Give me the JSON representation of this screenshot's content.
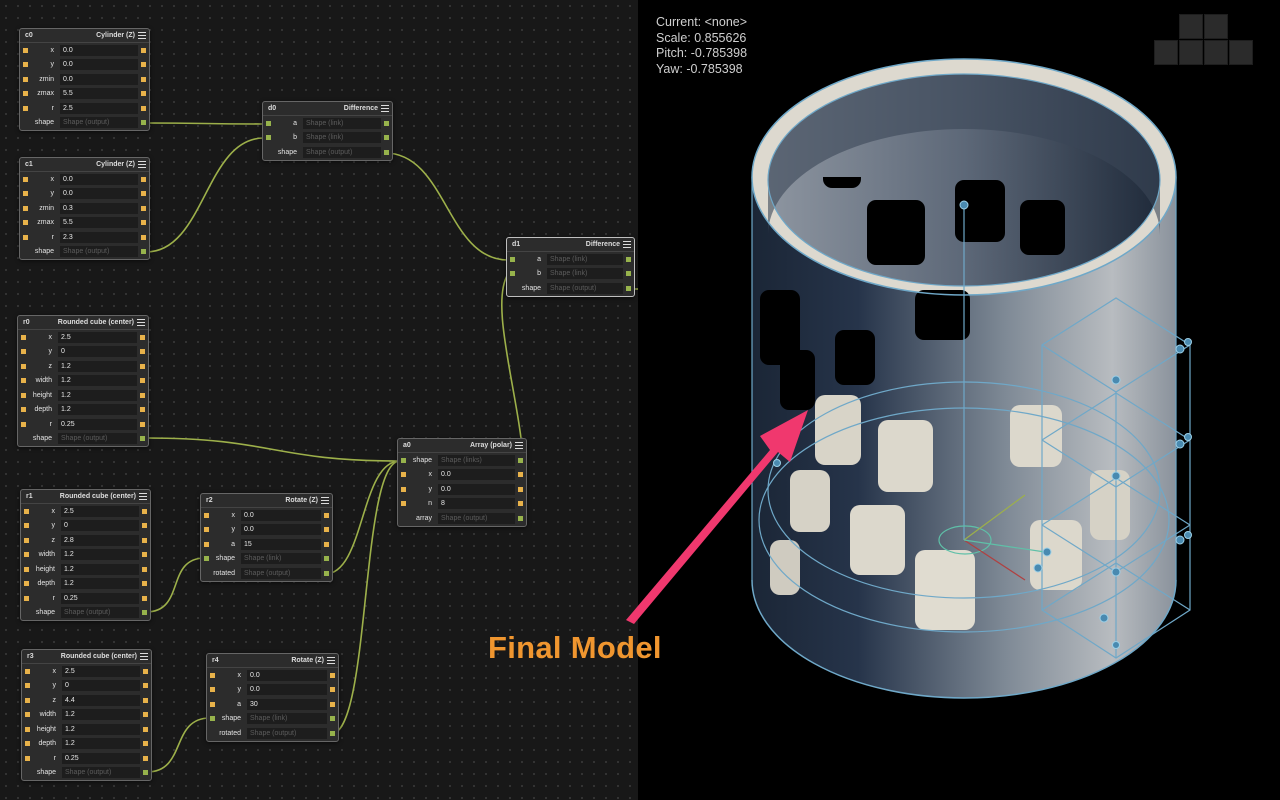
{
  "graph": {
    "nodes": [
      {
        "id": "c0",
        "title": "Cylinder (Z)",
        "rows": [
          {
            "label": "x",
            "value": "0.0"
          },
          {
            "label": "y",
            "value": "0.0"
          },
          {
            "label": "zmin",
            "value": "0.0"
          },
          {
            "label": "zmax",
            "value": "5.5"
          },
          {
            "label": "r",
            "value": "2.5"
          },
          {
            "label": "shape",
            "placeholder": "Shape (output)",
            "output": true
          }
        ]
      },
      {
        "id": "c1",
        "title": "Cylinder (Z)",
        "rows": [
          {
            "label": "x",
            "value": "0.0"
          },
          {
            "label": "y",
            "value": "0.0"
          },
          {
            "label": "zmin",
            "value": "0.3"
          },
          {
            "label": "zmax",
            "value": "5.5"
          },
          {
            "label": "r",
            "value": "2.3"
          },
          {
            "label": "shape",
            "placeholder": "Shape (output)",
            "output": true
          }
        ]
      },
      {
        "id": "d0",
        "title": "Difference",
        "rows": [
          {
            "label": "a",
            "placeholder": "Shape (link)",
            "link": true
          },
          {
            "label": "b",
            "placeholder": "Shape (link)",
            "link": true
          },
          {
            "label": "shape",
            "placeholder": "Shape (output)",
            "output": true
          }
        ]
      },
      {
        "id": "d1",
        "title": "Difference",
        "rows": [
          {
            "label": "a",
            "placeholder": "Shape (link)",
            "link": true
          },
          {
            "label": "b",
            "placeholder": "Shape (link)",
            "link": true
          },
          {
            "label": "shape",
            "placeholder": "Shape (output)",
            "output": true
          }
        ]
      },
      {
        "id": "r0",
        "title": "Rounded cube (center)",
        "rows": [
          {
            "label": "x",
            "value": "2.5"
          },
          {
            "label": "y",
            "value": "0"
          },
          {
            "label": "z",
            "value": "1.2"
          },
          {
            "label": "width",
            "value": "1.2"
          },
          {
            "label": "height",
            "value": "1.2"
          },
          {
            "label": "depth",
            "value": "1.2"
          },
          {
            "label": "r",
            "value": "0.25"
          },
          {
            "label": "shape",
            "placeholder": "Shape (output)",
            "output": true
          }
        ]
      },
      {
        "id": "a0",
        "title": "Array (polar)",
        "rows": [
          {
            "label": "shape",
            "placeholder": "Shape (links)",
            "link": true
          },
          {
            "label": "x",
            "value": "0.0"
          },
          {
            "label": "y",
            "value": "0.0"
          },
          {
            "label": "n",
            "value": "8"
          },
          {
            "label": "array",
            "placeholder": "Shape (output)",
            "output": true
          }
        ]
      },
      {
        "id": "r1",
        "title": "Rounded cube (center)",
        "rows": [
          {
            "label": "x",
            "value": "2.5"
          },
          {
            "label": "y",
            "value": "0"
          },
          {
            "label": "z",
            "value": "2.8"
          },
          {
            "label": "width",
            "value": "1.2"
          },
          {
            "label": "height",
            "value": "1.2"
          },
          {
            "label": "depth",
            "value": "1.2"
          },
          {
            "label": "r",
            "value": "0.25"
          },
          {
            "label": "shape",
            "placeholder": "Shape (output)",
            "output": true
          }
        ]
      },
      {
        "id": "r2",
        "title": "Rotate (Z)",
        "rows": [
          {
            "label": "x",
            "value": "0.0"
          },
          {
            "label": "y",
            "value": "0.0"
          },
          {
            "label": "a",
            "value": "15"
          },
          {
            "label": "shape",
            "placeholder": "Shape (link)",
            "link": true
          },
          {
            "label": "rotated",
            "placeholder": "Shape (output)",
            "output": true
          }
        ]
      },
      {
        "id": "r3",
        "title": "Rounded cube (center)",
        "rows": [
          {
            "label": "x",
            "value": "2.5"
          },
          {
            "label": "y",
            "value": "0"
          },
          {
            "label": "z",
            "value": "4.4"
          },
          {
            "label": "width",
            "value": "1.2"
          },
          {
            "label": "height",
            "value": "1.2"
          },
          {
            "label": "depth",
            "value": "1.2"
          },
          {
            "label": "r",
            "value": "0.25"
          },
          {
            "label": "shape",
            "placeholder": "Shape (output)",
            "output": true
          }
        ]
      },
      {
        "id": "r4",
        "title": "Rotate (Z)",
        "rows": [
          {
            "label": "x",
            "value": "0.0"
          },
          {
            "label": "y",
            "value": "0.0"
          },
          {
            "label": "a",
            "value": "30"
          },
          {
            "label": "shape",
            "placeholder": "Shape (link)",
            "link": true
          },
          {
            "label": "rotated",
            "placeholder": "Shape (output)",
            "output": true
          }
        ]
      }
    ]
  },
  "viewport": {
    "current": "Current: <none>",
    "scale": "Scale: 0.855626",
    "pitch": "Pitch: -0.785398",
    "yaw": "Yaw: -0.785398"
  },
  "callout": {
    "text": "Final Model",
    "color": "#f0962f",
    "arrow_color": "#f0386e"
  },
  "colors": {
    "wire": "#9db04a",
    "port_input": "#e8b24a",
    "port_link": "#97b34c",
    "wireframe": "#6fa8c8"
  }
}
